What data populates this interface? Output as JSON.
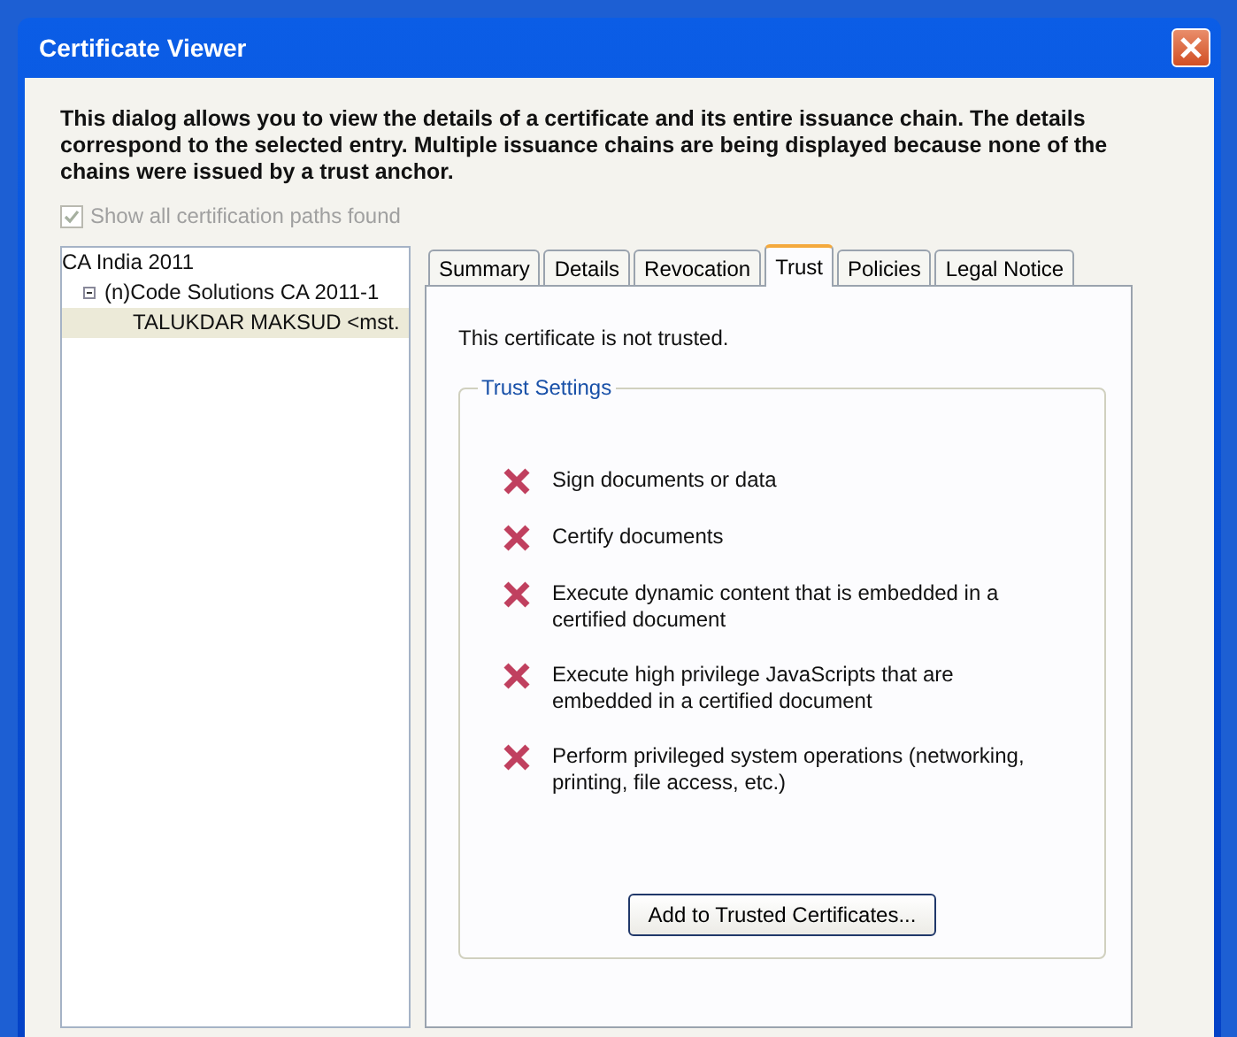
{
  "window": {
    "title": "Certificate Viewer"
  },
  "intro": "This dialog allows you to view the details of a certificate and its entire issuance chain. The details correspond to the selected entry. Multiple issuance chains are being displayed because none of the chains were issued by a trust anchor.",
  "show_all_paths": {
    "label": "Show all certification paths found",
    "checked": true,
    "disabled": true
  },
  "tree": [
    {
      "label": "CA India 2011",
      "selected": false,
      "children": [
        {
          "label": "(n)Code Solutions CA 2011-1",
          "selected": false,
          "expanded": true,
          "children": [
            {
              "label": "TALUKDAR MAKSUD <mst.",
              "selected": true
            }
          ]
        }
      ]
    }
  ],
  "tabs": [
    {
      "label": "Summary",
      "selected": false
    },
    {
      "label": "Details",
      "selected": false
    },
    {
      "label": "Revocation",
      "selected": false
    },
    {
      "label": "Trust",
      "selected": true
    },
    {
      "label": "Policies",
      "selected": false
    },
    {
      "label": "Legal Notice",
      "selected": false
    }
  ],
  "status": "This certificate is not trusted.",
  "trust_settings": {
    "title": "Trust Settings",
    "items": [
      {
        "label": "Sign documents or data",
        "allowed": false
      },
      {
        "label": "Certify documents",
        "allowed": false
      },
      {
        "label": "Execute dynamic content that is embedded in a certified document",
        "allowed": false
      },
      {
        "label": "Execute high privilege JavaScripts that are embedded in a certified document",
        "allowed": false
      },
      {
        "label": "Perform privileged system operations (networking, printing, file access, etc.)",
        "allowed": false
      }
    ]
  },
  "button": "Add to Trusted Certificates..."
}
